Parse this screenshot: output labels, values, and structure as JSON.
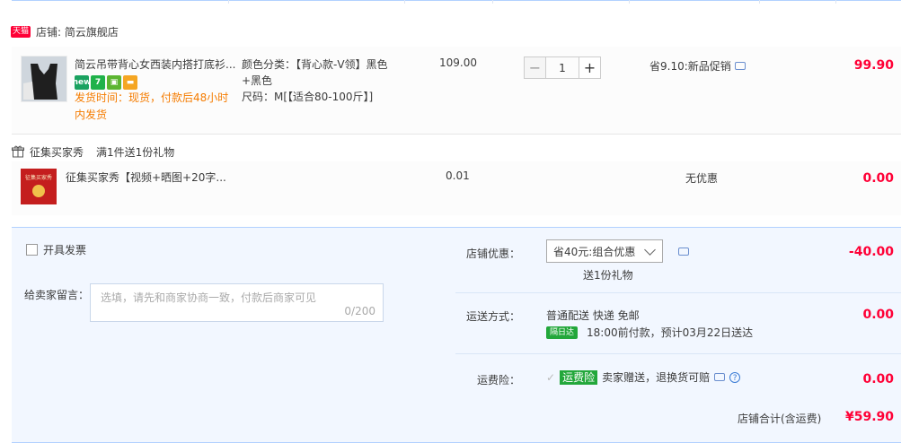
{
  "store": {
    "tag": "天猫",
    "name": "店铺: 简云旗舰店"
  },
  "item": {
    "title": "简云吊带背心女西装内搭打底衫...",
    "badges": [
      "new",
      "7",
      "",
      ""
    ],
    "shipping": "发货时间：现货，付款后48小时内发货",
    "sku_color": "颜色分类：【背心款-V领】黑色+黑色",
    "sku_size": "尺码：M[【适合80-100斤】]",
    "price": "109.00",
    "quantity": "1",
    "promo": "省9.10:新品促销",
    "subtotal": "99.90"
  },
  "gift": {
    "header": "征集买家秀",
    "rule": "满1件送1份礼物",
    "thumb_text": "征集买家秀",
    "title": "征集买家秀【视频+晒图+20字...",
    "price": "0.01",
    "promo": "无优惠",
    "subtotal": "0.00"
  },
  "invoice": {
    "label": "开具发票"
  },
  "message": {
    "label": "给卖家留言：",
    "placeholder": "选填，请先和商家协商一致，付款后商家可见",
    "count": "0/200"
  },
  "store_discount": {
    "label": "店铺优惠：",
    "selected": "省40元:组合优惠",
    "note": "送1份礼物",
    "value": "-40.00"
  },
  "delivery": {
    "label": "运送方式：",
    "method": "普通配送 快递 免邮",
    "badge": "隔日达",
    "eta": "18:00前付款，预计03月22日送达",
    "value": "0.00"
  },
  "insurance": {
    "label": "运费险：",
    "badge": "运费险",
    "desc": "卖家赠送，退换货可赔",
    "value": "0.00"
  },
  "total": {
    "label": "店铺合计(含运费)",
    "value": "¥59.90"
  },
  "colors": {
    "accent": "#ff0036",
    "panel": "#f2f7ff",
    "border": "#b2d1ff",
    "ship": "#f57c00",
    "green": "#23a73b"
  }
}
